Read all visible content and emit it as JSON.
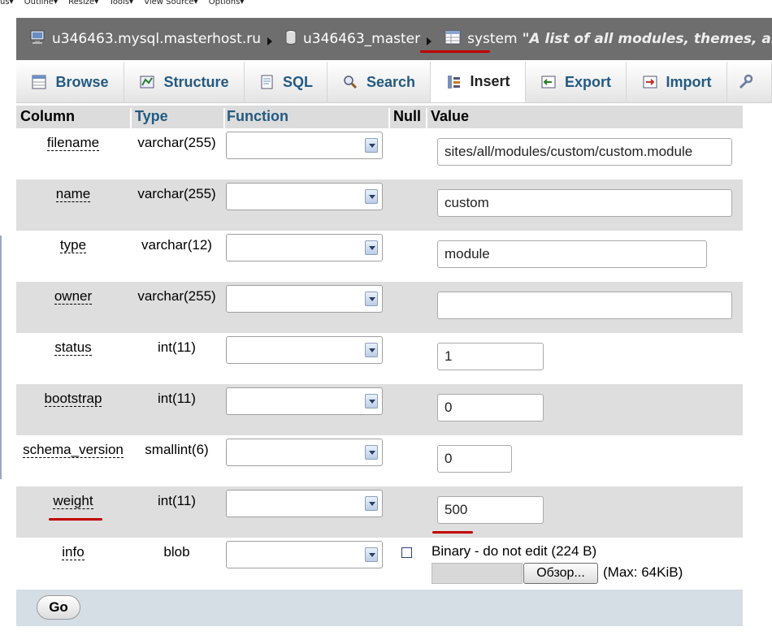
{
  "browser_toolbar": {
    "items": [
      "us▾",
      "Outline▾",
      "Resize▾",
      "Tools▾",
      "View Source▾",
      "Options▾"
    ]
  },
  "breadcrumb": {
    "server": "u346463.mysql.masterhost.ru",
    "database": "u346463_master",
    "table": "system",
    "comment": "\"A list of all modules, themes, and theme e"
  },
  "tabs": [
    {
      "label": "Browse"
    },
    {
      "label": "Structure"
    },
    {
      "label": "SQL"
    },
    {
      "label": "Search"
    },
    {
      "label": "Insert",
      "active": true
    },
    {
      "label": "Export"
    },
    {
      "label": "Import"
    }
  ],
  "table": {
    "headers": {
      "column": "Column",
      "type": "Type",
      "function": "Function",
      "null": "Null",
      "value": "Value"
    },
    "rows": [
      {
        "column": "filename",
        "type": "varchar(255)",
        "value": "sites/all/modules/custom/custom.module"
      },
      {
        "column": "name",
        "type": "varchar(255)",
        "value": "custom"
      },
      {
        "column": "type",
        "type": "varchar(12)",
        "value": "module"
      },
      {
        "column": "owner",
        "type": "varchar(255)",
        "value": ""
      },
      {
        "column": "status",
        "type": "int(11)",
        "value": "1"
      },
      {
        "column": "bootstrap",
        "type": "int(11)",
        "value": "0"
      },
      {
        "column": "schema_version",
        "type": "smallint(6)",
        "value": "0"
      },
      {
        "column": "weight",
        "type": "int(11)",
        "value": "500"
      },
      {
        "column": "info",
        "type": "blob",
        "binary_note": "Binary - do not edit (224 B)",
        "browse_label": "Обзор...",
        "max_label": "(Max: 64KiB)"
      }
    ]
  },
  "footer": {
    "go_label": "Go"
  },
  "colors": {
    "breadcrumb_bg": "#6e6e6e",
    "link": "#235a81",
    "annotation_red": "#c00000"
  }
}
